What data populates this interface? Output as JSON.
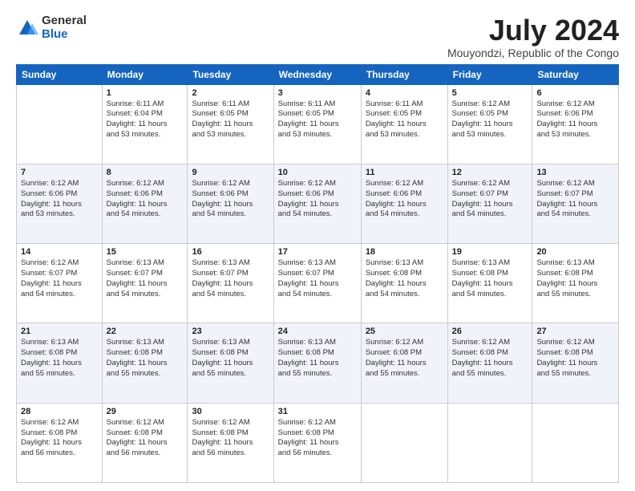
{
  "header": {
    "logo_general": "General",
    "logo_blue": "Blue",
    "month_title": "July 2024",
    "location": "Mouyondzi, Republic of the Congo"
  },
  "days_of_week": [
    "Sunday",
    "Monday",
    "Tuesday",
    "Wednesday",
    "Thursday",
    "Friday",
    "Saturday"
  ],
  "weeks": [
    [
      {
        "day": "",
        "info": ""
      },
      {
        "day": "1",
        "info": "Sunrise: 6:11 AM\nSunset: 6:04 PM\nDaylight: 11 hours\nand 53 minutes."
      },
      {
        "day": "2",
        "info": "Sunrise: 6:11 AM\nSunset: 6:05 PM\nDaylight: 11 hours\nand 53 minutes."
      },
      {
        "day": "3",
        "info": "Sunrise: 6:11 AM\nSunset: 6:05 PM\nDaylight: 11 hours\nand 53 minutes."
      },
      {
        "day": "4",
        "info": "Sunrise: 6:11 AM\nSunset: 6:05 PM\nDaylight: 11 hours\nand 53 minutes."
      },
      {
        "day": "5",
        "info": "Sunrise: 6:12 AM\nSunset: 6:05 PM\nDaylight: 11 hours\nand 53 minutes."
      },
      {
        "day": "6",
        "info": "Sunrise: 6:12 AM\nSunset: 6:06 PM\nDaylight: 11 hours\nand 53 minutes."
      }
    ],
    [
      {
        "day": "7",
        "info": "Sunrise: 6:12 AM\nSunset: 6:06 PM\nDaylight: 11 hours\nand 53 minutes."
      },
      {
        "day": "8",
        "info": "Sunrise: 6:12 AM\nSunset: 6:06 PM\nDaylight: 11 hours\nand 54 minutes."
      },
      {
        "day": "9",
        "info": "Sunrise: 6:12 AM\nSunset: 6:06 PM\nDaylight: 11 hours\nand 54 minutes."
      },
      {
        "day": "10",
        "info": "Sunrise: 6:12 AM\nSunset: 6:06 PM\nDaylight: 11 hours\nand 54 minutes."
      },
      {
        "day": "11",
        "info": "Sunrise: 6:12 AM\nSunset: 6:06 PM\nDaylight: 11 hours\nand 54 minutes."
      },
      {
        "day": "12",
        "info": "Sunrise: 6:12 AM\nSunset: 6:07 PM\nDaylight: 11 hours\nand 54 minutes."
      },
      {
        "day": "13",
        "info": "Sunrise: 6:12 AM\nSunset: 6:07 PM\nDaylight: 11 hours\nand 54 minutes."
      }
    ],
    [
      {
        "day": "14",
        "info": "Sunrise: 6:12 AM\nSunset: 6:07 PM\nDaylight: 11 hours\nand 54 minutes."
      },
      {
        "day": "15",
        "info": "Sunrise: 6:13 AM\nSunset: 6:07 PM\nDaylight: 11 hours\nand 54 minutes."
      },
      {
        "day": "16",
        "info": "Sunrise: 6:13 AM\nSunset: 6:07 PM\nDaylight: 11 hours\nand 54 minutes."
      },
      {
        "day": "17",
        "info": "Sunrise: 6:13 AM\nSunset: 6:07 PM\nDaylight: 11 hours\nand 54 minutes."
      },
      {
        "day": "18",
        "info": "Sunrise: 6:13 AM\nSunset: 6:08 PM\nDaylight: 11 hours\nand 54 minutes."
      },
      {
        "day": "19",
        "info": "Sunrise: 6:13 AM\nSunset: 6:08 PM\nDaylight: 11 hours\nand 54 minutes."
      },
      {
        "day": "20",
        "info": "Sunrise: 6:13 AM\nSunset: 6:08 PM\nDaylight: 11 hours\nand 55 minutes."
      }
    ],
    [
      {
        "day": "21",
        "info": "Sunrise: 6:13 AM\nSunset: 6:08 PM\nDaylight: 11 hours\nand 55 minutes."
      },
      {
        "day": "22",
        "info": "Sunrise: 6:13 AM\nSunset: 6:08 PM\nDaylight: 11 hours\nand 55 minutes."
      },
      {
        "day": "23",
        "info": "Sunrise: 6:13 AM\nSunset: 6:08 PM\nDaylight: 11 hours\nand 55 minutes."
      },
      {
        "day": "24",
        "info": "Sunrise: 6:13 AM\nSunset: 6:08 PM\nDaylight: 11 hours\nand 55 minutes."
      },
      {
        "day": "25",
        "info": "Sunrise: 6:12 AM\nSunset: 6:08 PM\nDaylight: 11 hours\nand 55 minutes."
      },
      {
        "day": "26",
        "info": "Sunrise: 6:12 AM\nSunset: 6:08 PM\nDaylight: 11 hours\nand 55 minutes."
      },
      {
        "day": "27",
        "info": "Sunrise: 6:12 AM\nSunset: 6:08 PM\nDaylight: 11 hours\nand 55 minutes."
      }
    ],
    [
      {
        "day": "28",
        "info": "Sunrise: 6:12 AM\nSunset: 6:08 PM\nDaylight: 11 hours\nand 56 minutes."
      },
      {
        "day": "29",
        "info": "Sunrise: 6:12 AM\nSunset: 6:08 PM\nDaylight: 11 hours\nand 56 minutes."
      },
      {
        "day": "30",
        "info": "Sunrise: 6:12 AM\nSunset: 6:08 PM\nDaylight: 11 hours\nand 56 minutes."
      },
      {
        "day": "31",
        "info": "Sunrise: 6:12 AM\nSunset: 6:08 PM\nDaylight: 11 hours\nand 56 minutes."
      },
      {
        "day": "",
        "info": ""
      },
      {
        "day": "",
        "info": ""
      },
      {
        "day": "",
        "info": ""
      }
    ]
  ]
}
